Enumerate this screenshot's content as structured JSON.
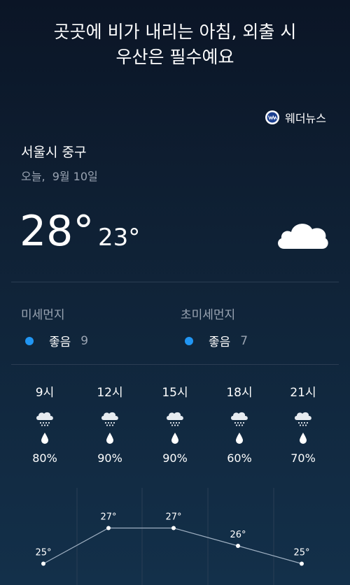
{
  "headline": {
    "line1": "곳곳에 비가 내리는 아침, 외출 시",
    "line2": "우산은 필수예요"
  },
  "source": {
    "name": "웨더뉴스",
    "icon": "weathernews-logo-icon"
  },
  "location": "서울시 중구",
  "date": "오늘,  9월 10일",
  "temperature": {
    "high": "28°",
    "low": "23°",
    "condition_icon": "cloud-icon"
  },
  "dust": [
    {
      "label": "미세먼지",
      "status": "좋음",
      "value": "9",
      "color": "#2196f3"
    },
    {
      "label": "초미세먼지",
      "status": "좋음",
      "value": "7",
      "color": "#2196f3"
    }
  ],
  "hourly": [
    {
      "time": "9시",
      "icon": "cloud-rain-icon",
      "precip": "80%"
    },
    {
      "time": "12시",
      "icon": "cloud-rain-icon",
      "precip": "90%"
    },
    {
      "time": "15시",
      "icon": "cloud-rain-icon",
      "precip": "90%"
    },
    {
      "time": "18시",
      "icon": "cloud-rain-icon",
      "precip": "60%"
    },
    {
      "time": "21시",
      "icon": "cloud-rain-icon",
      "precip": "70%"
    }
  ],
  "chart_data": {
    "type": "line",
    "categories": [
      "9시",
      "12시",
      "15시",
      "18시",
      "21시"
    ],
    "values": [
      25,
      27,
      27,
      26,
      25
    ],
    "labels": [
      "25°",
      "27°",
      "27°",
      "26°",
      "25°"
    ],
    "ylim": [
      24,
      28
    ]
  }
}
